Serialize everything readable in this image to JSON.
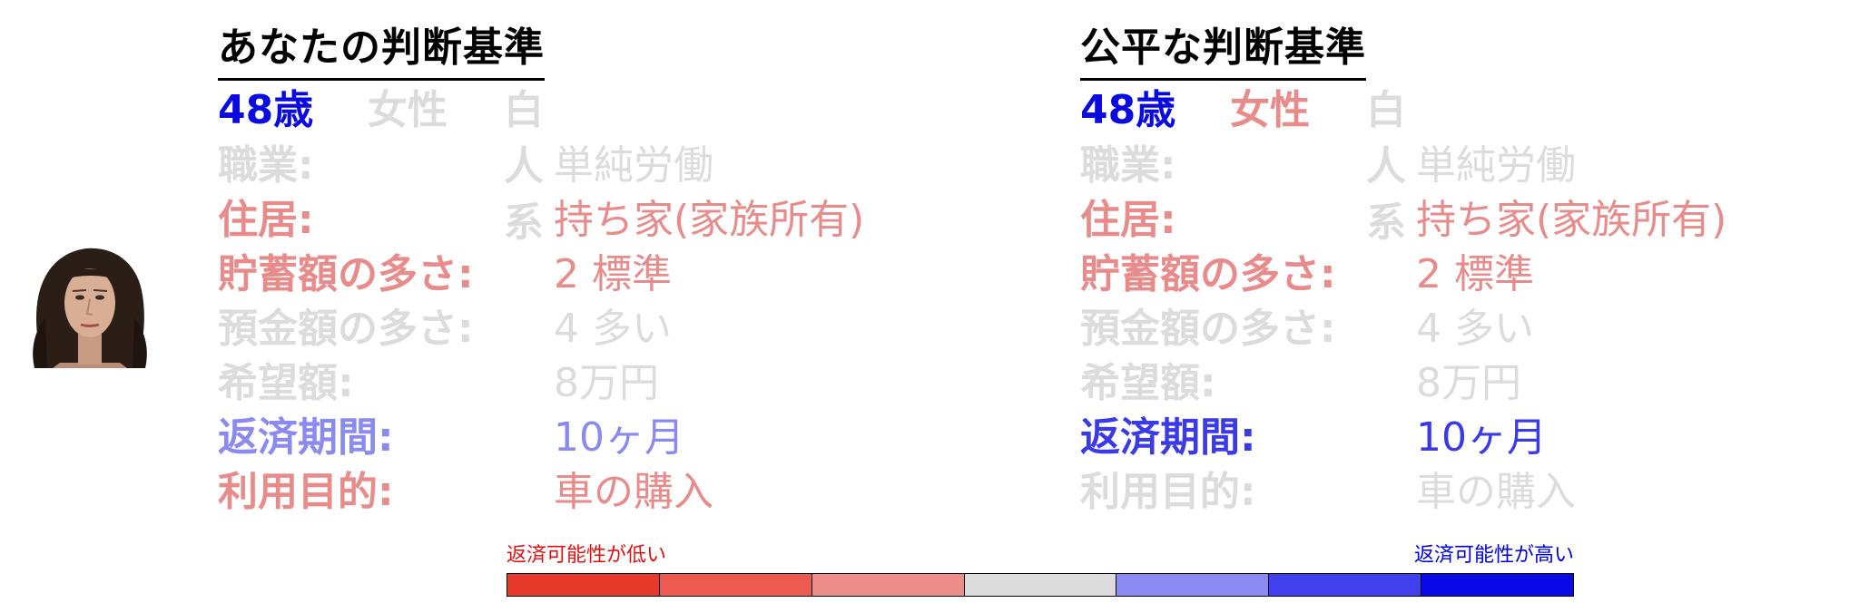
{
  "colors": {
    "gray": "#dcdcdc",
    "red_mid": "#e88b8b",
    "blue_mid": "#8a8af0",
    "blue_dark": "#3a3ae8",
    "blue_strong": "#0a0ae0",
    "legend_low": "#e01010",
    "legend_high": "#0000e0"
  },
  "left": {
    "title": "あなたの判断基準",
    "age": "48歳",
    "gender": "女性",
    "race": "白人系",
    "rows": [
      {
        "label": "職業:",
        "value": "単純労働",
        "label_color": "#dcdcdc",
        "value_color": "#dcdcdc"
      },
      {
        "label": "住居:",
        "value": "持ち家(家族所有)",
        "label_color": "#e88b8b",
        "value_color": "#e88b8b"
      },
      {
        "label": "貯蓄額の多さ:",
        "value": "2 標準",
        "label_color": "#e88b8b",
        "value_color": "#e88b8b"
      },
      {
        "label": "預金額の多さ:",
        "value": "4 多い",
        "label_color": "#dcdcdc",
        "value_color": "#dcdcdc"
      },
      {
        "label": "希望額:",
        "value": "8万円",
        "label_color": "#dcdcdc",
        "value_color": "#dcdcdc"
      },
      {
        "label": "返済期間:",
        "value": "10ヶ月",
        "label_color": "#8a8af0",
        "value_color": "#8a8af0"
      },
      {
        "label": "利用目的:",
        "value": "車の購入",
        "label_color": "#e88b8b",
        "value_color": "#e88b8b"
      }
    ]
  },
  "right": {
    "title": "公平な判断基準",
    "age": "48歳",
    "gender": "女性",
    "race": "白人系",
    "rows": [
      {
        "label": "職業:",
        "value": "単純労働",
        "label_color": "#dcdcdc",
        "value_color": "#dcdcdc"
      },
      {
        "label": "住居:",
        "value": "持ち家(家族所有)",
        "label_color": "#e88b8b",
        "value_color": "#e88b8b"
      },
      {
        "label": "貯蓄額の多さ:",
        "value": "2 標準",
        "label_color": "#e88b8b",
        "value_color": "#e88b8b"
      },
      {
        "label": "預金額の多さ:",
        "value": "4 多い",
        "label_color": "#dcdcdc",
        "value_color": "#dcdcdc"
      },
      {
        "label": "希望額:",
        "value": "8万円",
        "label_color": "#dcdcdc",
        "value_color": "#dcdcdc"
      },
      {
        "label": "返済期間:",
        "value": "10ヶ月",
        "label_color": "#3a3ae8",
        "value_color": "#3a3ae8"
      },
      {
        "label": "利用目的:",
        "value": "車の購入",
        "label_color": "#dcdcdc",
        "value_color": "#dcdcdc"
      }
    ]
  },
  "legend": {
    "low_label": "返済可能性が低い",
    "high_label": "返済可能性が高い",
    "scale_colors": [
      "#e83a2a",
      "#ec5a50",
      "#ee8e8a",
      "#dcdcdc",
      "#8a8af2",
      "#4040ee",
      "#0a0ae8"
    ]
  }
}
